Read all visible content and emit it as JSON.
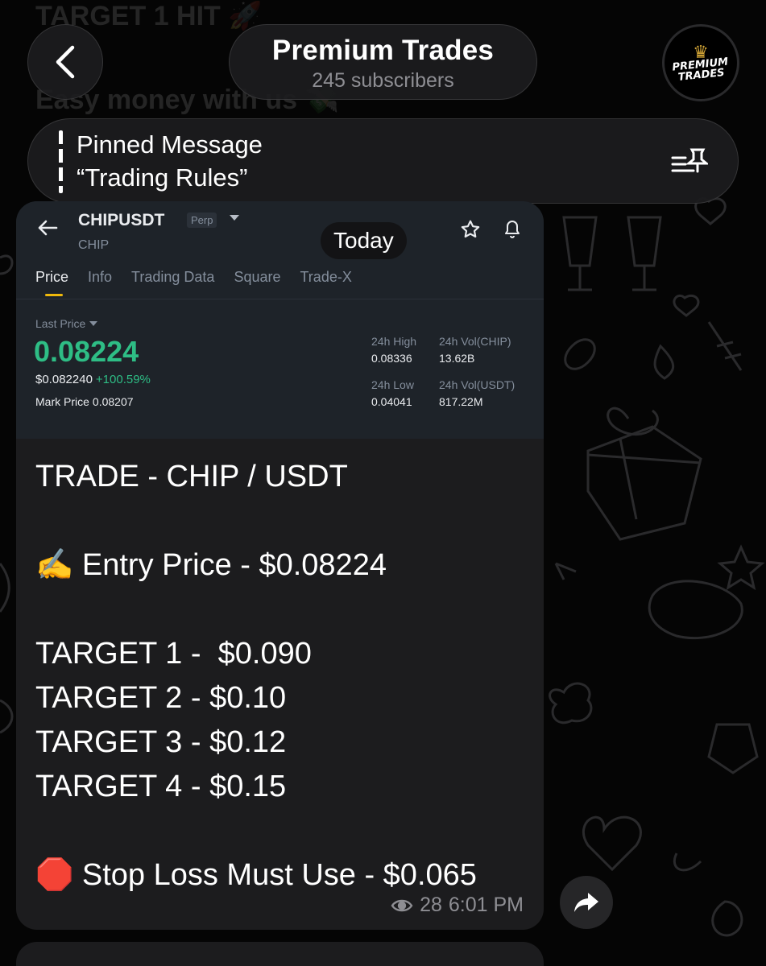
{
  "ghost": {
    "line1": "TARGET 1 HIT 🚀",
    "line2": "Easy money with us 💸"
  },
  "header": {
    "title": "Premium Trades",
    "subtitle": "245 subscribers",
    "avatar_text": "PREMIUM TRADES"
  },
  "pinned": {
    "title": "Pinned Message",
    "text": "“Trading Rules”"
  },
  "date_chip": "Today",
  "screenshot": {
    "symbol": "CHIPUSDT",
    "contract": "Perp",
    "coin": "CHIP",
    "tabs": [
      "Price",
      "Info",
      "Trading Data",
      "Square",
      "Trade-X"
    ],
    "last_price_label": "Last Price",
    "last_price": "0.08224",
    "usd_price": "$0.082240",
    "change": "+100.59%",
    "mark_price_label": "Mark Price",
    "mark_price": "0.08207",
    "high_label": "24h High",
    "high": "0.08336",
    "vol_chip_label": "24h Vol(CHIP)",
    "vol_chip": "13.62B",
    "low_label": "24h Low",
    "low": "0.04041",
    "vol_usdt_label": "24h Vol(USDT)",
    "vol_usdt": "817.22M",
    "colors": {
      "up": "#2ebd85",
      "accent": "#f0b90b"
    }
  },
  "message": {
    "text": "TRADE - CHIP / USDT\n\n✍️ Entry Price - $0.08224\n\nTARGET 1 -  $0.090\nTARGET 2 - $0.10\nTARGET 3 - $0.12\nTARGET 4 - $0.15\n\n🛑 Stop Loss Must Use - $0.065",
    "views": "28",
    "time": "6:01 PM"
  },
  "icons": [
    "back-chevron-icon",
    "pin-list-icon",
    "arrow-left-icon",
    "star-icon",
    "bell-icon",
    "eye-icon",
    "share-arrow-icon"
  ]
}
